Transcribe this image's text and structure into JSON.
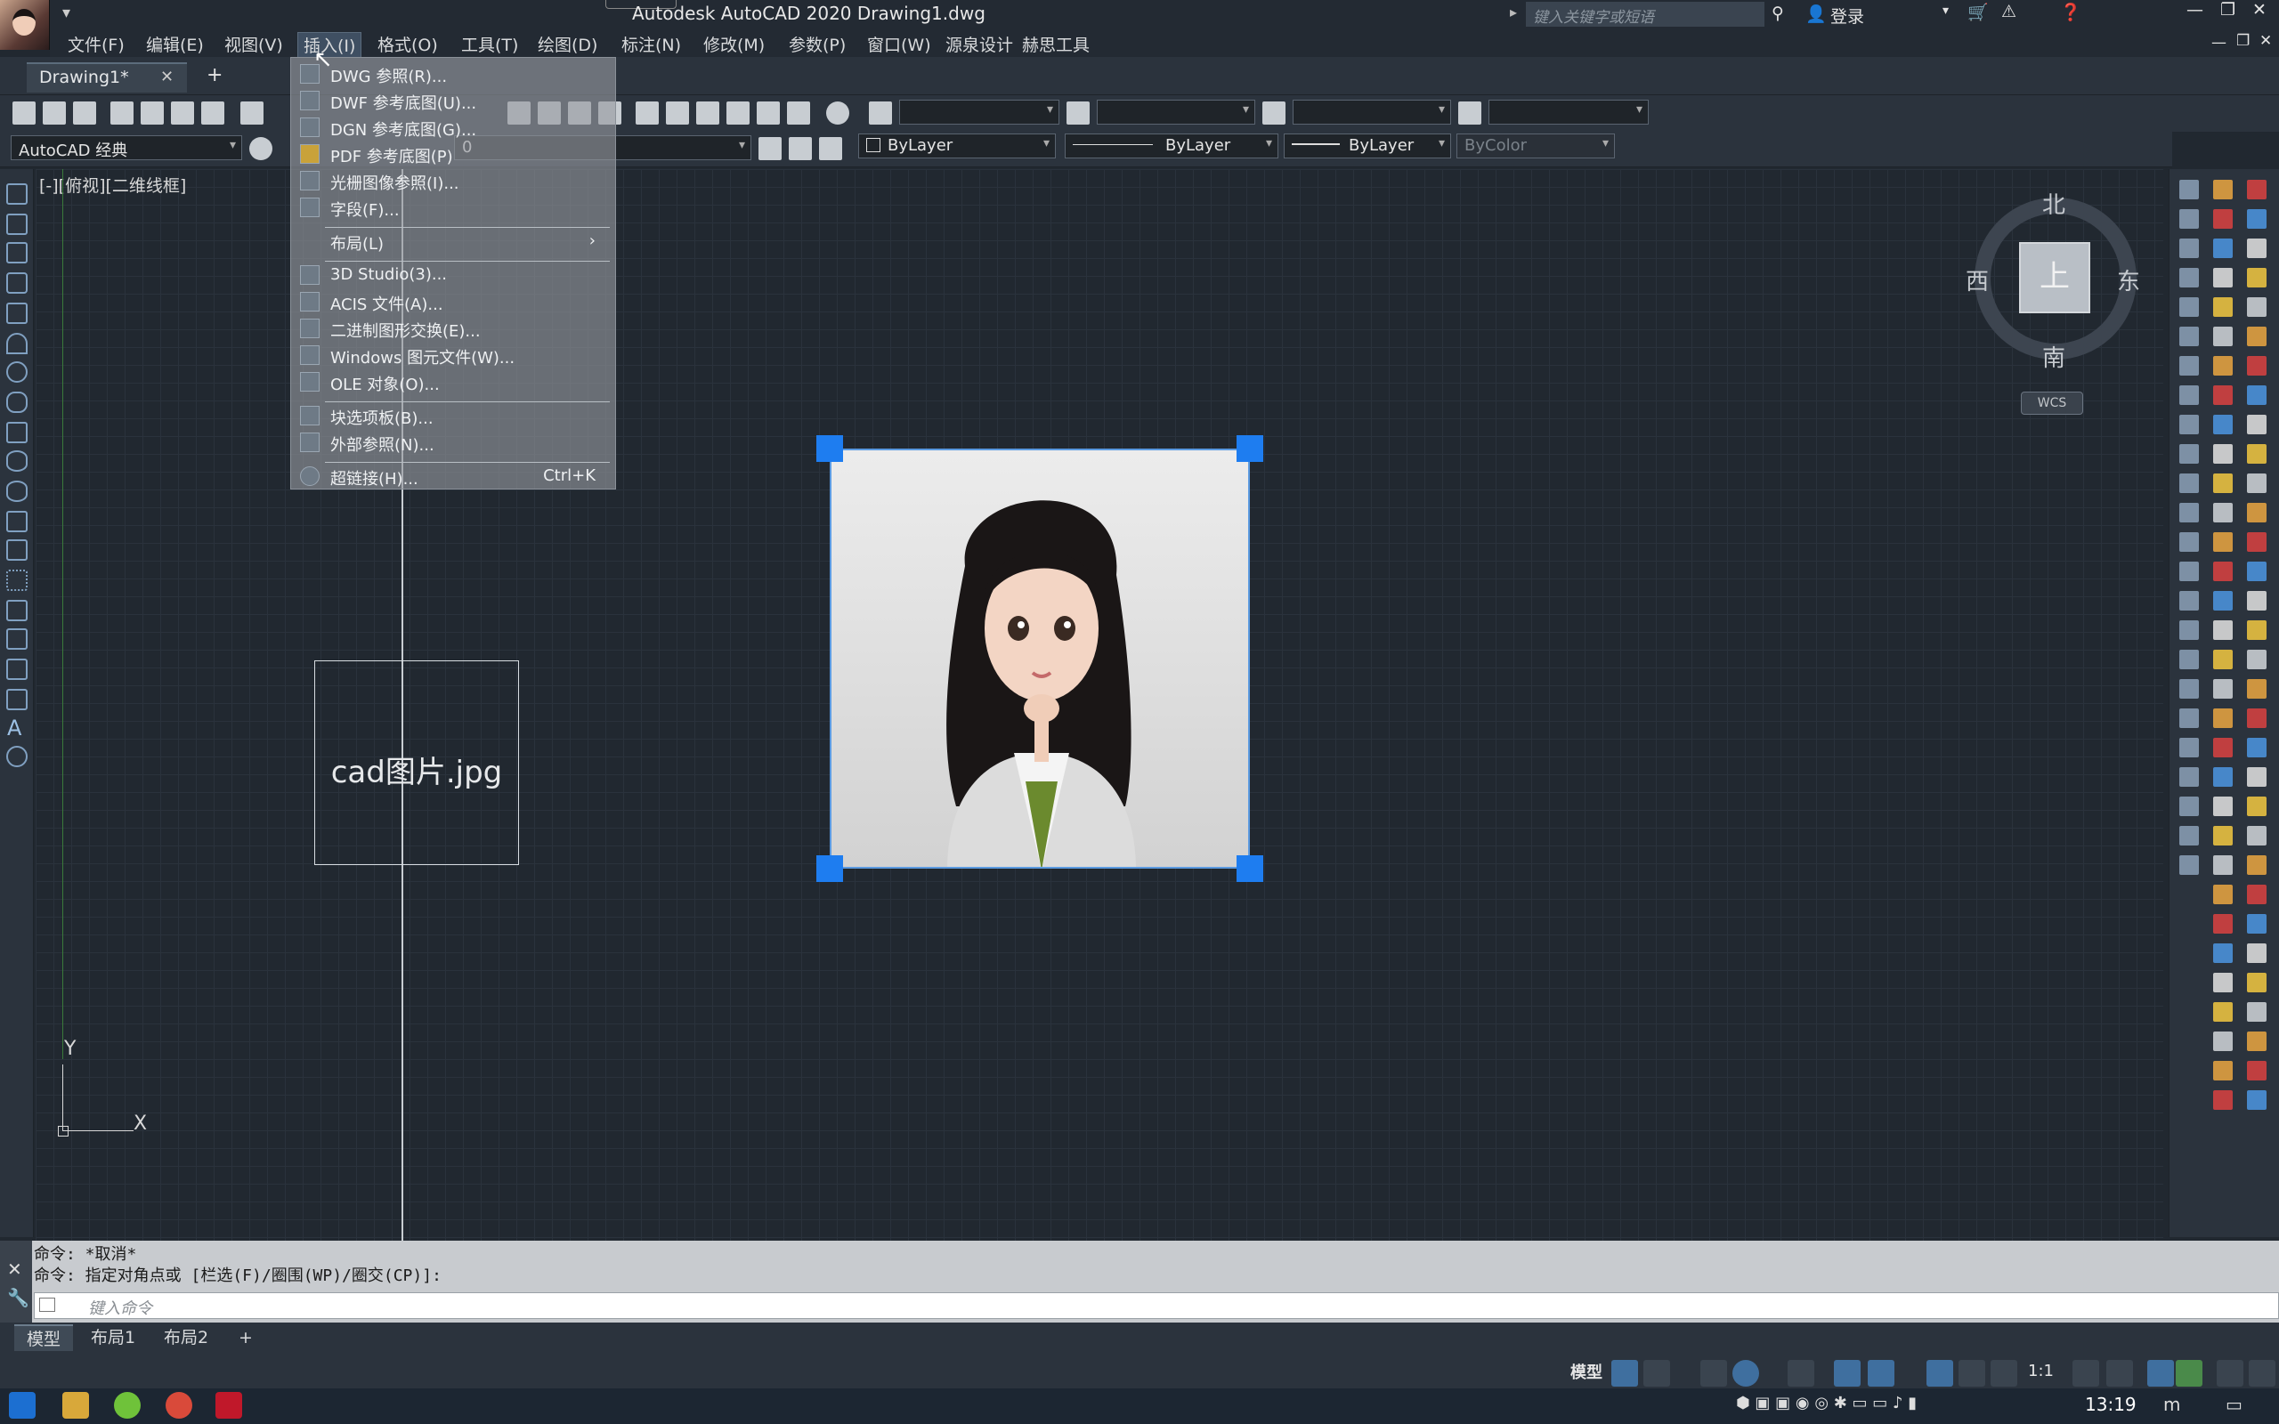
{
  "app": {
    "title": "Autodesk AutoCAD 2020    Drawing1.dwg",
    "search_placeholder": "键入关键字或短语",
    "login_label": "登录"
  },
  "menubar": [
    {
      "label": "文件(F)"
    },
    {
      "label": "编辑(E)"
    },
    {
      "label": "视图(V)"
    },
    {
      "label": "插入(I)"
    },
    {
      "label": "格式(O)"
    },
    {
      "label": "工具(T)"
    },
    {
      "label": "绘图(D)"
    },
    {
      "label": "标注(N)"
    },
    {
      "label": "修改(M)"
    },
    {
      "label": "参数(P)"
    },
    {
      "label": "窗口(W)"
    },
    {
      "label": "源泉设计"
    },
    {
      "label": "赫思工具"
    }
  ],
  "doc_tab": {
    "label": "Drawing1*",
    "close": "✕",
    "add": "+"
  },
  "toolbar2": {
    "workspace": "AutoCAD 经典",
    "layer": "0",
    "color": "ByLayer",
    "linetype": "ByLayer",
    "lineweight": "ByLayer",
    "plotstyle": "ByColor"
  },
  "view": {
    "label": "[-][俯视][二维线框]"
  },
  "insert_menu": {
    "items": [
      {
        "label": "DWG 参照(R)...",
        "shortcut": ""
      },
      {
        "label": "DWF 参考底图(U)...",
        "shortcut": ""
      },
      {
        "label": "DGN 参考底图(G)...",
        "shortcut": ""
      },
      {
        "label": "PDF 参考底图(P)",
        "shortcut": ""
      },
      {
        "label": "光栅图像参照(I)...",
        "shortcut": ""
      },
      {
        "label": "字段(F)...",
        "shortcut": ""
      },
      {
        "label": "布局(L)",
        "shortcut": "›"
      },
      {
        "label": "3D Studio(3)...",
        "shortcut": ""
      },
      {
        "label": "ACIS 文件(A)...",
        "shortcut": ""
      },
      {
        "label": "二进制图形交换(E)...",
        "shortcut": ""
      },
      {
        "label": "Windows 图元文件(W)...",
        "shortcut": ""
      },
      {
        "label": "OLE 对象(O)...",
        "shortcut": ""
      },
      {
        "label": "块选项板(B)...",
        "shortcut": ""
      },
      {
        "label": "外部参照(N)...",
        "shortcut": ""
      },
      {
        "label": "超链接(H)...",
        "shortcut": "Ctrl+K"
      }
    ]
  },
  "canvas": {
    "image_frame_label": "cad图片.jpg",
    "ucs_x": "X",
    "ucs_y": "Y"
  },
  "viewcube": {
    "north": "北",
    "south": "南",
    "east": "东",
    "west": "西",
    "face": "上",
    "wcs": "WCS"
  },
  "command": {
    "history": [
      "命令: *取消*",
      "命令: 指定对角点或 [栏选(F)/圈围(WP)/圈交(CP)]:"
    ],
    "placeholder": "键入命令"
  },
  "layout_tabs": [
    {
      "label": "模型"
    },
    {
      "label": "布局1"
    },
    {
      "label": "布局2"
    }
  ],
  "status": {
    "model": "模型",
    "scale": "1:1"
  },
  "taskbar": {
    "time": "13:19"
  }
}
